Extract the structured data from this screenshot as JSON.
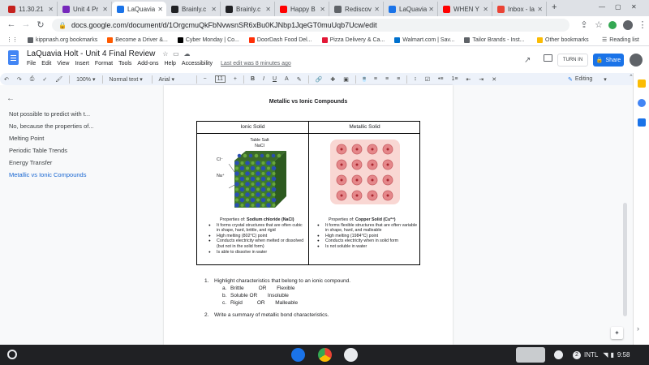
{
  "browser": {
    "tabs": [
      {
        "label": "11.30.21",
        "color": "#c5221f"
      },
      {
        "label": "Unit 4 Pr",
        "color": "#7627bb"
      },
      {
        "label": "LaQuavia",
        "color": "#1a73e8"
      },
      {
        "label": "Brainly.c",
        "color": "#202124"
      },
      {
        "label": "Brainly.c",
        "color": "#202124"
      },
      {
        "label": "Happy B",
        "color": "#ff0000"
      },
      {
        "label": "Rediscov",
        "color": "#5f6368"
      },
      {
        "label": "LaQuavia",
        "color": "#1a73e8"
      },
      {
        "label": "WHEN Y",
        "color": "#ff0000"
      },
      {
        "label": "Inbox - la",
        "color": "#ea4335"
      }
    ],
    "new_tab": "+",
    "url": "docs.google.com/document/d/1OrgcmuQkFbNvwsnSR6xBu0KJNbp1JqeGT0muUqb7Ucw/edit",
    "bookmarks": [
      {
        "label": "kippnash.org bookmarks",
        "color": "#5f6368"
      },
      {
        "label": "Become a Driver &...",
        "color": "#ff5a00"
      },
      {
        "label": "Cyber Monday | Co...",
        "color": "#000000"
      },
      {
        "label": "DoorDash Food Del...",
        "color": "#ff3008"
      },
      {
        "label": "Pizza Delivery & Ca...",
        "color": "#e31837"
      },
      {
        "label": "Walmart.com | Sav...",
        "color": "#0071ce"
      },
      {
        "label": "Tailor Brands - Inst...",
        "color": "#5f6368"
      }
    ],
    "other_bookmarks": "Other bookmarks",
    "reading_list": "Reading list"
  },
  "docs": {
    "title": "LaQuavia Holt - Unit 4 Final Review",
    "menus": [
      "File",
      "Edit",
      "View",
      "Insert",
      "Format",
      "Tools",
      "Add-ons",
      "Help",
      "Accessibility"
    ],
    "last_edit": "Last edit was 8 minutes ago",
    "turn_in": "TURN IN",
    "share": "Share",
    "toolbar": {
      "zoom": "100%",
      "style": "Normal text",
      "font": "Arial",
      "font_size": "11",
      "mode": "Editing"
    }
  },
  "outline": {
    "items": [
      {
        "label": "Not possible to predict with t...",
        "active": false
      },
      {
        "label": "No, because the properties of...",
        "active": false
      },
      {
        "label": "Melting Point",
        "active": false
      },
      {
        "label": "Periodic Table Trends",
        "active": false
      },
      {
        "label": "Energy Transfer",
        "active": false
      },
      {
        "label": "Metallic vs Ionic Compounds",
        "active": true
      }
    ]
  },
  "document": {
    "heading": "Metallic vs Ionic Compounds",
    "table": {
      "headers": [
        "Ionic Solid",
        "Metallic Solid"
      ],
      "ionic": {
        "image_title": "Table Salt",
        "image_formula": "NaCl",
        "label_cl": "Cl⁻",
        "label_na": "Na⁺",
        "caption_prefix": "Properties of: ",
        "caption_bold": "Sodium chloride (NaCl)",
        "properties": [
          "It forms crystal structures that are often cubic in shape, hard, brittle, and rigid",
          "High melting (802°C) point",
          "Conducts electricity when melted or dissolved (but not in the solid form)",
          "Is able to dissolve in water"
        ]
      },
      "metallic": {
        "caption_prefix": "Properties of: ",
        "caption_bold": "Copper Solid (Cu²⁺)",
        "properties": [
          "It forms flexible structures that are often variable in shape, hard, and malleable",
          "High melting (1984°C) point",
          "Conducts electricity when in solid form",
          "Is not soluble in water"
        ]
      }
    },
    "questions": {
      "q1_number": "1.",
      "q1_text": "Highlight characteristics that belong to an ionic compound.",
      "options": [
        {
          "letter": "a.",
          "text": "Brittle          OR       Flexible"
        },
        {
          "letter": "b.",
          "text": "Soluble OR       Insoluble"
        },
        {
          "letter": "c.",
          "text": "Rigid          OR       Malleable"
        }
      ],
      "q2_number": "2.",
      "q2_text": "Write a summary of metallic bond characteristics."
    }
  },
  "taskbar": {
    "network_badge": "2",
    "language": "INTL",
    "time": "9:58"
  }
}
